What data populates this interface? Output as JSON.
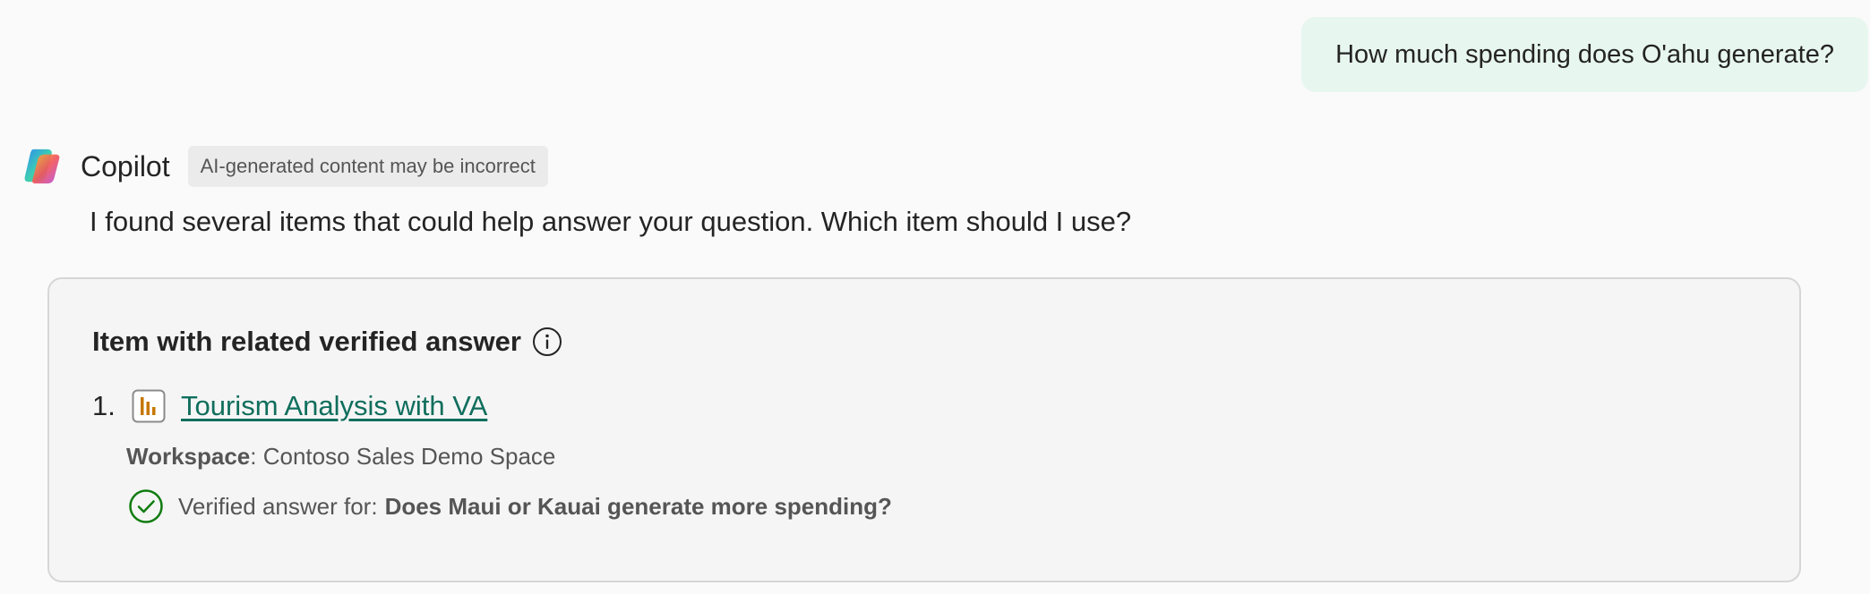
{
  "user_message": {
    "text": "How much spending does O'ahu generate?"
  },
  "copilot": {
    "name": "Copilot",
    "badge": "AI-generated content may be incorrect",
    "intro": "I found several items that could help answer your question. Which item should I use?"
  },
  "card": {
    "title": "Item with related verified answer",
    "items": [
      {
        "number": "1.",
        "icon": "report-icon",
        "title": "Tourism Analysis with VA",
        "workspace_label": "Workspace",
        "workspace_sep": ":",
        "workspace_value": "Contoso Sales Demo Space",
        "verified_prefix": "Verified answer for:",
        "verified_question": "Does Maui or Kauai generate more spending?"
      }
    ]
  },
  "colors": {
    "background": "#fafafa",
    "user_bubble": "#e8f6f0",
    "link": "#0f6e5c",
    "verified_check": "#107c10",
    "report_icon": "#c77700"
  }
}
